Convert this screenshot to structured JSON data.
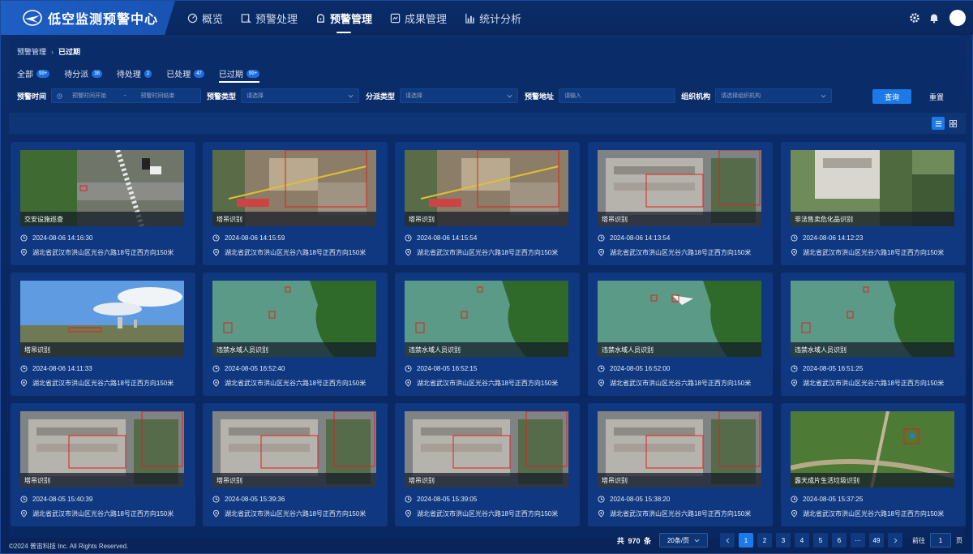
{
  "app": {
    "title": "低空监测预警中心"
  },
  "nav": [
    {
      "label": "概览",
      "icon": "dashboard-icon",
      "active": false
    },
    {
      "label": "预警处理",
      "icon": "alert-handle-icon",
      "active": false
    },
    {
      "label": "预警管理",
      "icon": "alert-manage-icon",
      "active": true
    },
    {
      "label": "成果管理",
      "icon": "result-manage-icon",
      "active": false
    },
    {
      "label": "统计分析",
      "icon": "chart-icon",
      "active": false
    }
  ],
  "breadcrumb": {
    "parent": "预警管理",
    "current": "已过期"
  },
  "tabs": [
    {
      "label": "全部",
      "badge": "99+"
    },
    {
      "label": "待分派",
      "badge": "38"
    },
    {
      "label": "待处理",
      "badge": "2"
    },
    {
      "label": "已处理",
      "badge": "47"
    },
    {
      "label": "已过期",
      "badge": "99+"
    }
  ],
  "filters": {
    "time_label": "预警时间",
    "time_start_placeholder": "预警时间开始",
    "time_sep": "-",
    "time_end_placeholder": "预警时间结束",
    "type_label": "预警类型",
    "type_placeholder": "请选择",
    "dispatch_label": "分派类型",
    "dispatch_placeholder": "请选择",
    "address_label": "预警地址",
    "address_placeholder": "请输入",
    "org_label": "组织机构",
    "org_placeholder": "请选择组织机构",
    "query": "查询",
    "reset": "重置"
  },
  "cards": [
    {
      "label": "交安设施巡查",
      "time": "2024-08-06 14:16:30",
      "address": "湖北省武汉市洪山区光谷六路18号正西方向150米",
      "scene": "road"
    },
    {
      "label": "塔吊识别",
      "time": "2024-08-06 14:15:59",
      "address": "湖北省武汉市洪山区光谷六路18号正西方向150米",
      "scene": "site"
    },
    {
      "label": "塔吊识别",
      "time": "2024-08-06 14:15:54",
      "address": "湖北省武汉市洪山区光谷六路18号正西方向150米",
      "scene": "site"
    },
    {
      "label": "塔吊识别",
      "time": "2024-08-06 14:13:54",
      "address": "湖北省武汉市洪山区光谷六路18号正西方向150米",
      "scene": "roof"
    },
    {
      "label": "非法售卖危化品识别",
      "time": "2024-08-06 14:12:23",
      "address": "湖北省武汉市洪山区光谷六路18号正西方向150米",
      "scene": "building"
    },
    {
      "label": "塔吊识别",
      "time": "2024-08-06 14:11:33",
      "address": "湖北省武汉市洪山区光谷六路18号正西方向150米",
      "scene": "sky"
    },
    {
      "label": "违禁水域人员识别",
      "time": "2024-08-05 16:52:40",
      "address": "湖北省武汉市洪山区光谷六路18号正西方向150米",
      "scene": "water"
    },
    {
      "label": "违禁水域人员识别",
      "time": "2024-08-05 16:52:15",
      "address": "湖北省武汉市洪山区光谷六路18号正西方向150米",
      "scene": "water"
    },
    {
      "label": "违禁水域人员识别",
      "time": "2024-08-05 16:52:00",
      "address": "湖北省武汉市洪山区光谷六路18号正西方向150米",
      "scene": "water2"
    },
    {
      "label": "违禁水域人员识别",
      "time": "2024-08-05 16:51:25",
      "address": "湖北省武汉市洪山区光谷六路18号正西方向150米",
      "scene": "water"
    },
    {
      "label": "塔吊识别",
      "time": "2024-08-05 15:40:39",
      "address": "湖北省武汉市洪山区光谷六路18号正西方向150米",
      "scene": "roof"
    },
    {
      "label": "塔吊识别",
      "time": "2024-08-05 15:39:36",
      "address": "湖北省武汉市洪山区光谷六路18号正西方向150米",
      "scene": "roof"
    },
    {
      "label": "塔吊识别",
      "time": "2024-08-05 15:39:05",
      "address": "湖北省武汉市洪山区光谷六路18号正西方向150米",
      "scene": "roof"
    },
    {
      "label": "塔吊识别",
      "time": "2024-08-05 15:38:20",
      "address": "湖北省武汉市洪山区光谷六路18号正西方向150米",
      "scene": "roof"
    },
    {
      "label": "露天成片生活垃圾识别",
      "time": "2024-08-05 15:37:25",
      "address": "湖北省武汉市洪山区光谷六路18号正西方向150米",
      "scene": "field"
    }
  ],
  "footer": {
    "copyright": "©2024 普宙科技 Inc. All Rights Reserved."
  },
  "pagination": {
    "total_prefix": "共",
    "total": "970",
    "total_suffix": "条",
    "page_size": "20条/页",
    "pages": [
      "1",
      "2",
      "3",
      "4",
      "5",
      "6",
      "···",
      "49"
    ],
    "current": "1",
    "goto_label": "前往",
    "goto_value": "1",
    "goto_suffix": "页"
  },
  "colors": {
    "accent": "#1c7ae8",
    "background": "#0a2a63",
    "card": "#0f3880",
    "detect_box": "#e02020"
  }
}
